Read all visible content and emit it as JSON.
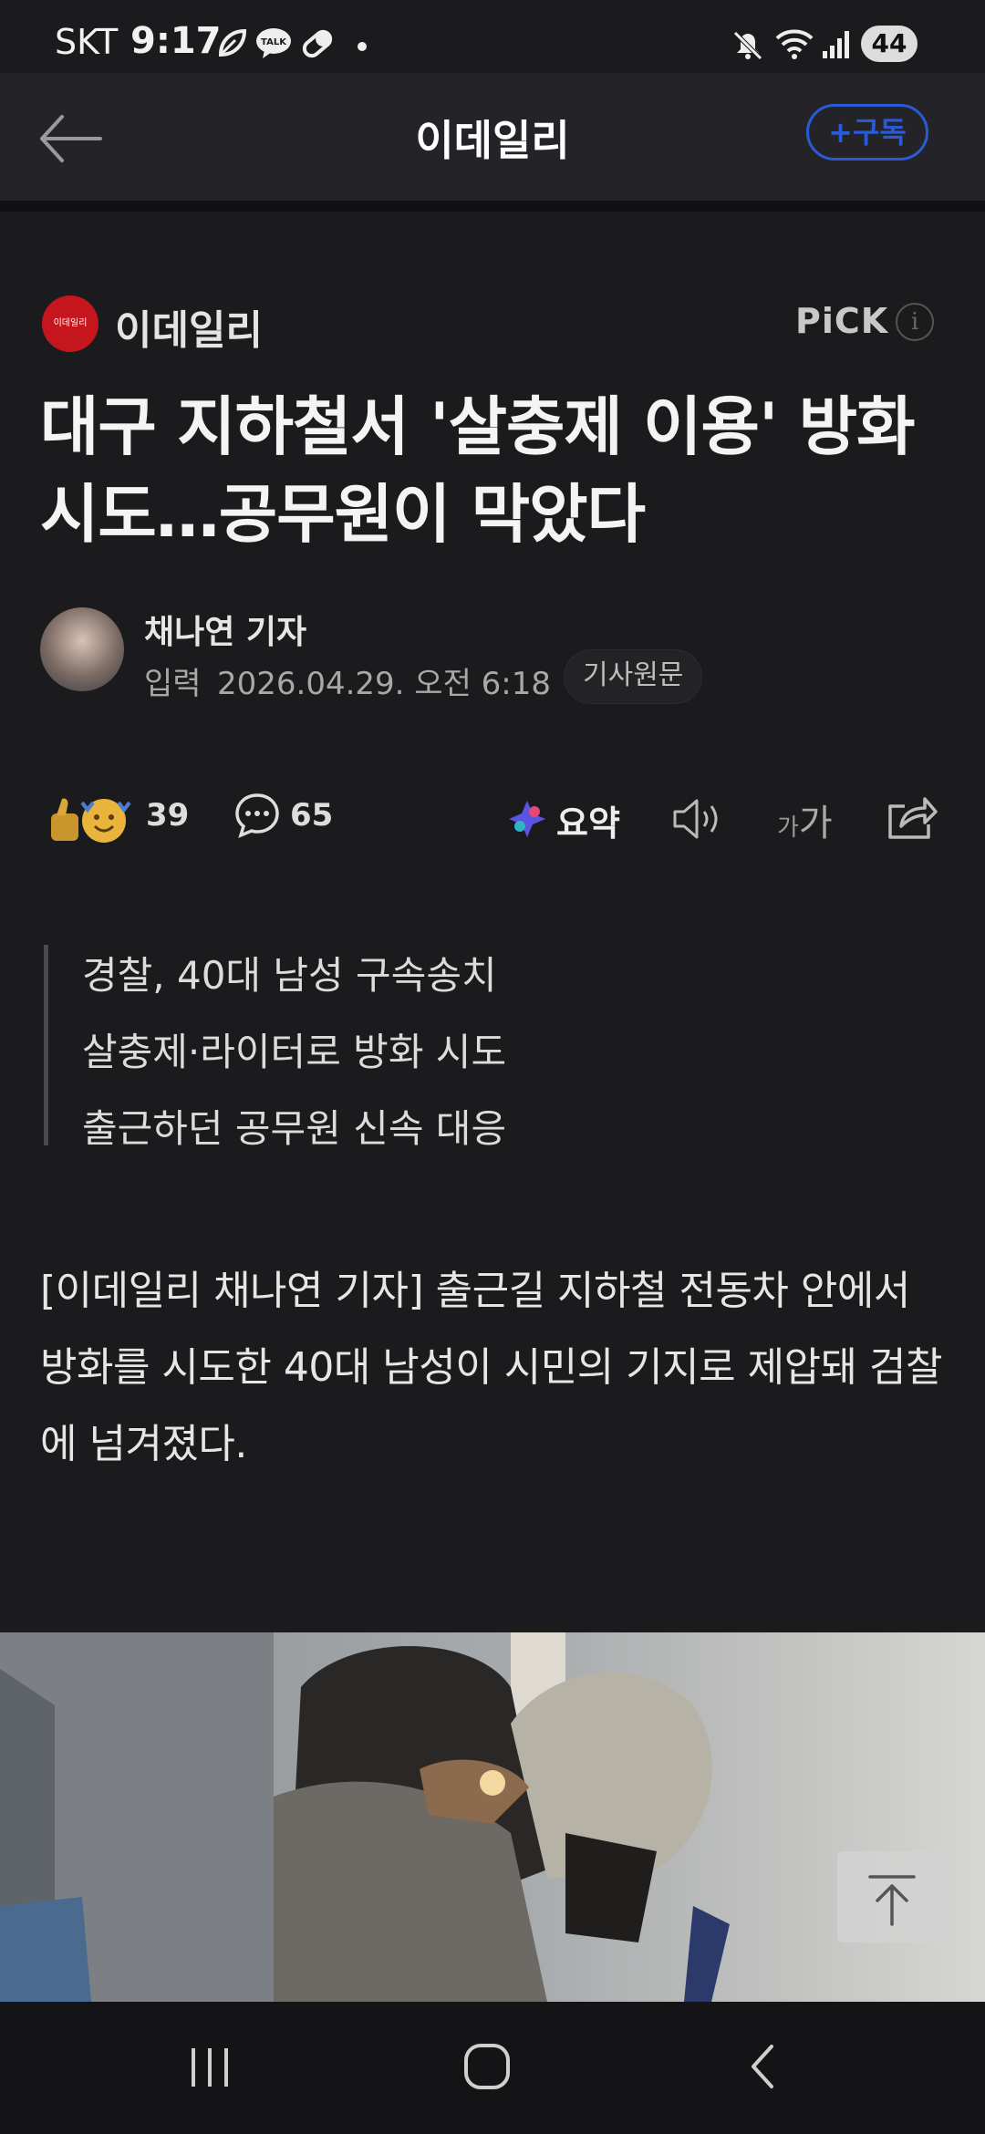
{
  "status_bar": {
    "carrier": "SKT",
    "time": "9:17",
    "battery": "44",
    "icons": [
      "leaf-icon",
      "talk-icon",
      "pill-icon",
      "dot-icon",
      "mute-icon",
      "wifi-icon",
      "signal-icon"
    ]
  },
  "app_bar": {
    "title": "이데일리",
    "subscribe_label": "+구독"
  },
  "publisher": {
    "name": "이데일리",
    "logo_text": "이데일리",
    "pick_label": "PiCK",
    "info_glyph": "i"
  },
  "article": {
    "headline": "대구 지하철서 '살충제 이용' 방화 시도…공무원이 막았다",
    "reporter": "채나연 기자",
    "input_label": "입력",
    "date": "2026.04.29. 오전 6:18",
    "original_label": "기사원문",
    "summary_lines": [
      "경찰, 40대 남성 구속송치",
      "살충제·라이터로 방화 시도",
      "출근하던 공무원 신속 대응"
    ],
    "body": "[이데일리 채나연 기자] 출근길 지하철 전동차 안에서 방화를 시도한 40대 남성이 시민의 기지로 제압돼 검찰에 넘겨졌다."
  },
  "actions": {
    "like_count": "39",
    "comment_count": "65",
    "summary_label": "요약",
    "font_small": "가",
    "font_large": "가"
  },
  "colors": {
    "background": "#1b1b1d",
    "app_bar": "#242428",
    "subscribe_accent": "#2a5bd7",
    "brand_red": "#c4161c"
  }
}
